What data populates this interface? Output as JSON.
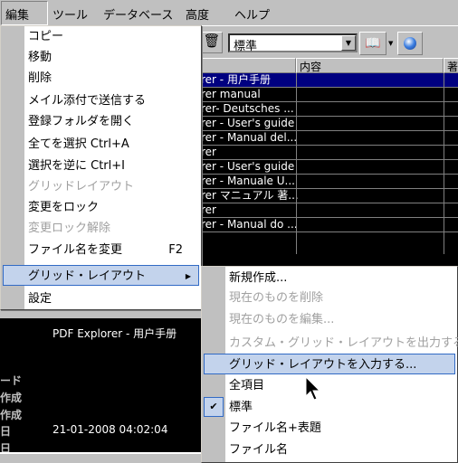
{
  "menubar": [
    "編集",
    "ツール",
    "データベース",
    "高度",
    "ヘルプ"
  ],
  "toolbar": {
    "layout_combo": "標準"
  },
  "grid": {
    "headers": [
      "内容",
      "著"
    ],
    "rows": [
      "rer - 用户手册",
      "rer manual",
      "rer- Deutsches ...",
      "rer - User's guide",
      "rer - Manual del...",
      "rer",
      "rer - User's guide",
      "rer - Manuale U...",
      "rer マニュアル 著...",
      "rer",
      "rer - Manual do ..."
    ],
    "selected_row": 0
  },
  "detail": {
    "title": "PDF Explorer - 用户手册",
    "labels": [
      "ード",
      "作成",
      "作成",
      "日",
      "日"
    ],
    "date": "21-01-2008 04:02:04"
  },
  "edit_menu": {
    "items": [
      {
        "label": "コピー"
      },
      {
        "label": "移動"
      },
      {
        "label": "削除"
      },
      {
        "label": "メイル添付で送信する"
      },
      {
        "label": "登録フォルダを開く"
      },
      {
        "label": "全てを選択 Ctrl+A",
        "shortcut": "Ctrl+A"
      },
      {
        "label": "選択を逆に Ctrl+I",
        "shortcut": "Ctrl+I"
      },
      {
        "label": "グリッドレイアウト",
        "disabled": true
      },
      {
        "label": "変更をロック"
      },
      {
        "label": "変更ロック解除",
        "disabled": true
      },
      {
        "label": "ファイル名を変更",
        "shortcut": "F2"
      },
      {
        "label": "グリッド・レイアウト",
        "highlighted": true,
        "submenu": true
      },
      {
        "label": "設定"
      }
    ]
  },
  "submenu": {
    "items": [
      {
        "label": "新規作成..."
      },
      {
        "label": "現在のものを削除",
        "disabled": true
      },
      {
        "label": "現在のものを編集...",
        "disabled": true
      },
      {
        "label": "カスタム・グリッド・レイアウトを出力する...",
        "disabled": true
      },
      {
        "label": "グリッド・レイアウトを入力する...",
        "highlighted": true
      },
      {
        "label": "全項目"
      },
      {
        "label": "標準",
        "checked": true
      },
      {
        "label": "ファイル名+表題"
      },
      {
        "label": "ファイル名"
      }
    ]
  },
  "colors": {
    "selection": "#000080",
    "menu_highlight": "#c3d3ec",
    "highlight_border": "#316ac5"
  }
}
